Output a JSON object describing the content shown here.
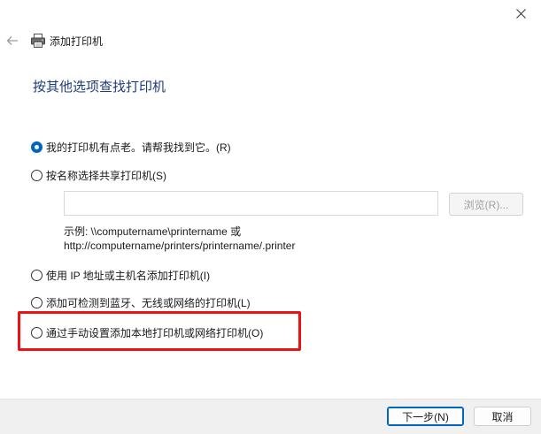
{
  "window": {
    "title": "添加打印机",
    "close_symbol": "✕"
  },
  "page": {
    "heading": "按其他选项查找打印机"
  },
  "options": [
    {
      "label": "我的打印机有点老。请帮我找到它。(R)",
      "selected": true
    },
    {
      "label": "按名称选择共享打印机(S)",
      "selected": false
    },
    {
      "label": "使用 IP 地址或主机名添加打印机(I)",
      "selected": false
    },
    {
      "label": "添加可检测到蓝牙、无线或网络的打印机(L)",
      "selected": false
    },
    {
      "label": "通过手动设置添加本地打印机或网络打印机(O)",
      "selected": false
    }
  ],
  "share": {
    "input_value": "",
    "browse_label": "浏览(R)...",
    "example_line1": "示例: \\\\computername\\printername 或",
    "example_line2": "http://computername/printers/printername/.printer"
  },
  "footer": {
    "next_label": "下一步(N)",
    "cancel_label": "取消"
  },
  "colors": {
    "accent": "#0067c0",
    "heading": "#1e3d7a",
    "highlight": "#ee1111"
  }
}
